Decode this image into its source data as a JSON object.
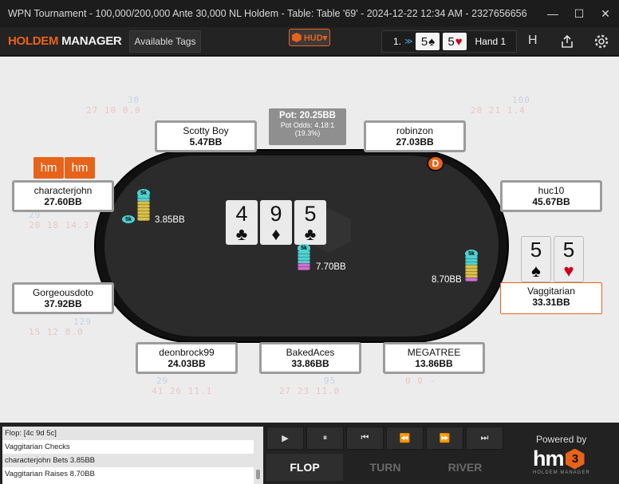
{
  "window": {
    "title": "WPN Tournament - 100,000/200,000 Ante 30,000 NL Holdem - Table: Table '69' - 2024-12-22 12:34 AM - 2327656656",
    "minimize": "—",
    "maximize": "☐",
    "close": "✕"
  },
  "toolbar": {
    "logo_part1": "HOLDEM",
    "logo_part2": " MANAGER",
    "tags_label": "Available Tags",
    "hud_label": "HUD▾",
    "hand_prefix": "1.",
    "hand_cards": [
      {
        "rank": "5",
        "suit": "♠",
        "color": "#111111"
      },
      {
        "rank": "5",
        "suit": "♥",
        "color": "#d0021b"
      }
    ],
    "hand_label": "Hand 1",
    "h_label": "H"
  },
  "pot": {
    "label": "Pot: 20.25BB",
    "odds": "Pot Odds: 4.18:1",
    "pct": "(19.3%)"
  },
  "board": [
    {
      "rank": "4",
      "suit": "♣",
      "color": "#111111"
    },
    {
      "rank": "9",
      "suit": "♦",
      "color": "#d0021b"
    },
    {
      "rank": "5",
      "suit": "♣",
      "color": "#111111"
    }
  ],
  "hero_cards": [
    {
      "rank": "5",
      "suit": "♠",
      "color": "#111111"
    },
    {
      "rank": "5",
      "suit": "♥",
      "color": "#d0021b"
    }
  ],
  "dealer": "D",
  "seats": [
    {
      "name": "Scotty Boy",
      "stack": "5.47BB"
    },
    {
      "name": "robinzon",
      "stack": "27.03BB"
    },
    {
      "name": "characterjohn",
      "stack": "27.60BB"
    },
    {
      "name": "huc10",
      "stack": "45.67BB"
    },
    {
      "name": "Gorgeousdoto",
      "stack": "37.92BB"
    },
    {
      "name": "Vaggitarian",
      "stack": "33.31BB"
    },
    {
      "name": "deonbrock99",
      "stack": "24.03BB"
    },
    {
      "name": "BakedAces",
      "stack": "33.86BB"
    },
    {
      "name": "MEGATREE",
      "stack": "13.86BB"
    }
  ],
  "hm_buttons": [
    "hm",
    "hm"
  ],
  "bets": [
    {
      "amount": "3.85BB",
      "chip": "5k"
    },
    {
      "amount": "7.70BB",
      "chip": "5k"
    },
    {
      "amount": "8.70BB",
      "chip": "5k"
    }
  ],
  "huds": [
    {
      "l1": "30",
      "l2": "27 10 0.0"
    },
    {
      "l1": "100",
      "l2": "20 21 1.4"
    },
    {
      "l1": "29",
      "l2": "20 18 14.3"
    },
    {
      "l1": "129",
      "l2": "15 12 0.0"
    },
    {
      "l1": "29",
      "l2": "41 26 11.1"
    },
    {
      "l1": "95",
      "l2": "27 23 11.0"
    },
    {
      "l1": "",
      "l2": "0 0 -"
    }
  ],
  "log": [
    "Flop: [4c 9d 5c]",
    "Vaggitarian Checks",
    "characterjohn Bets 3.85BB",
    "Vaggitarian Raises 8.70BB"
  ],
  "playback": [
    "▶",
    "⏸",
    "⏮",
    "⏪",
    "⏩",
    "⏭"
  ],
  "streets": [
    "FLOP",
    "TURN",
    "RIVER"
  ],
  "branding": {
    "powered": "Powered by",
    "hm": "hm",
    "hex": "3",
    "sub": "HOLDEM MANAGER"
  }
}
